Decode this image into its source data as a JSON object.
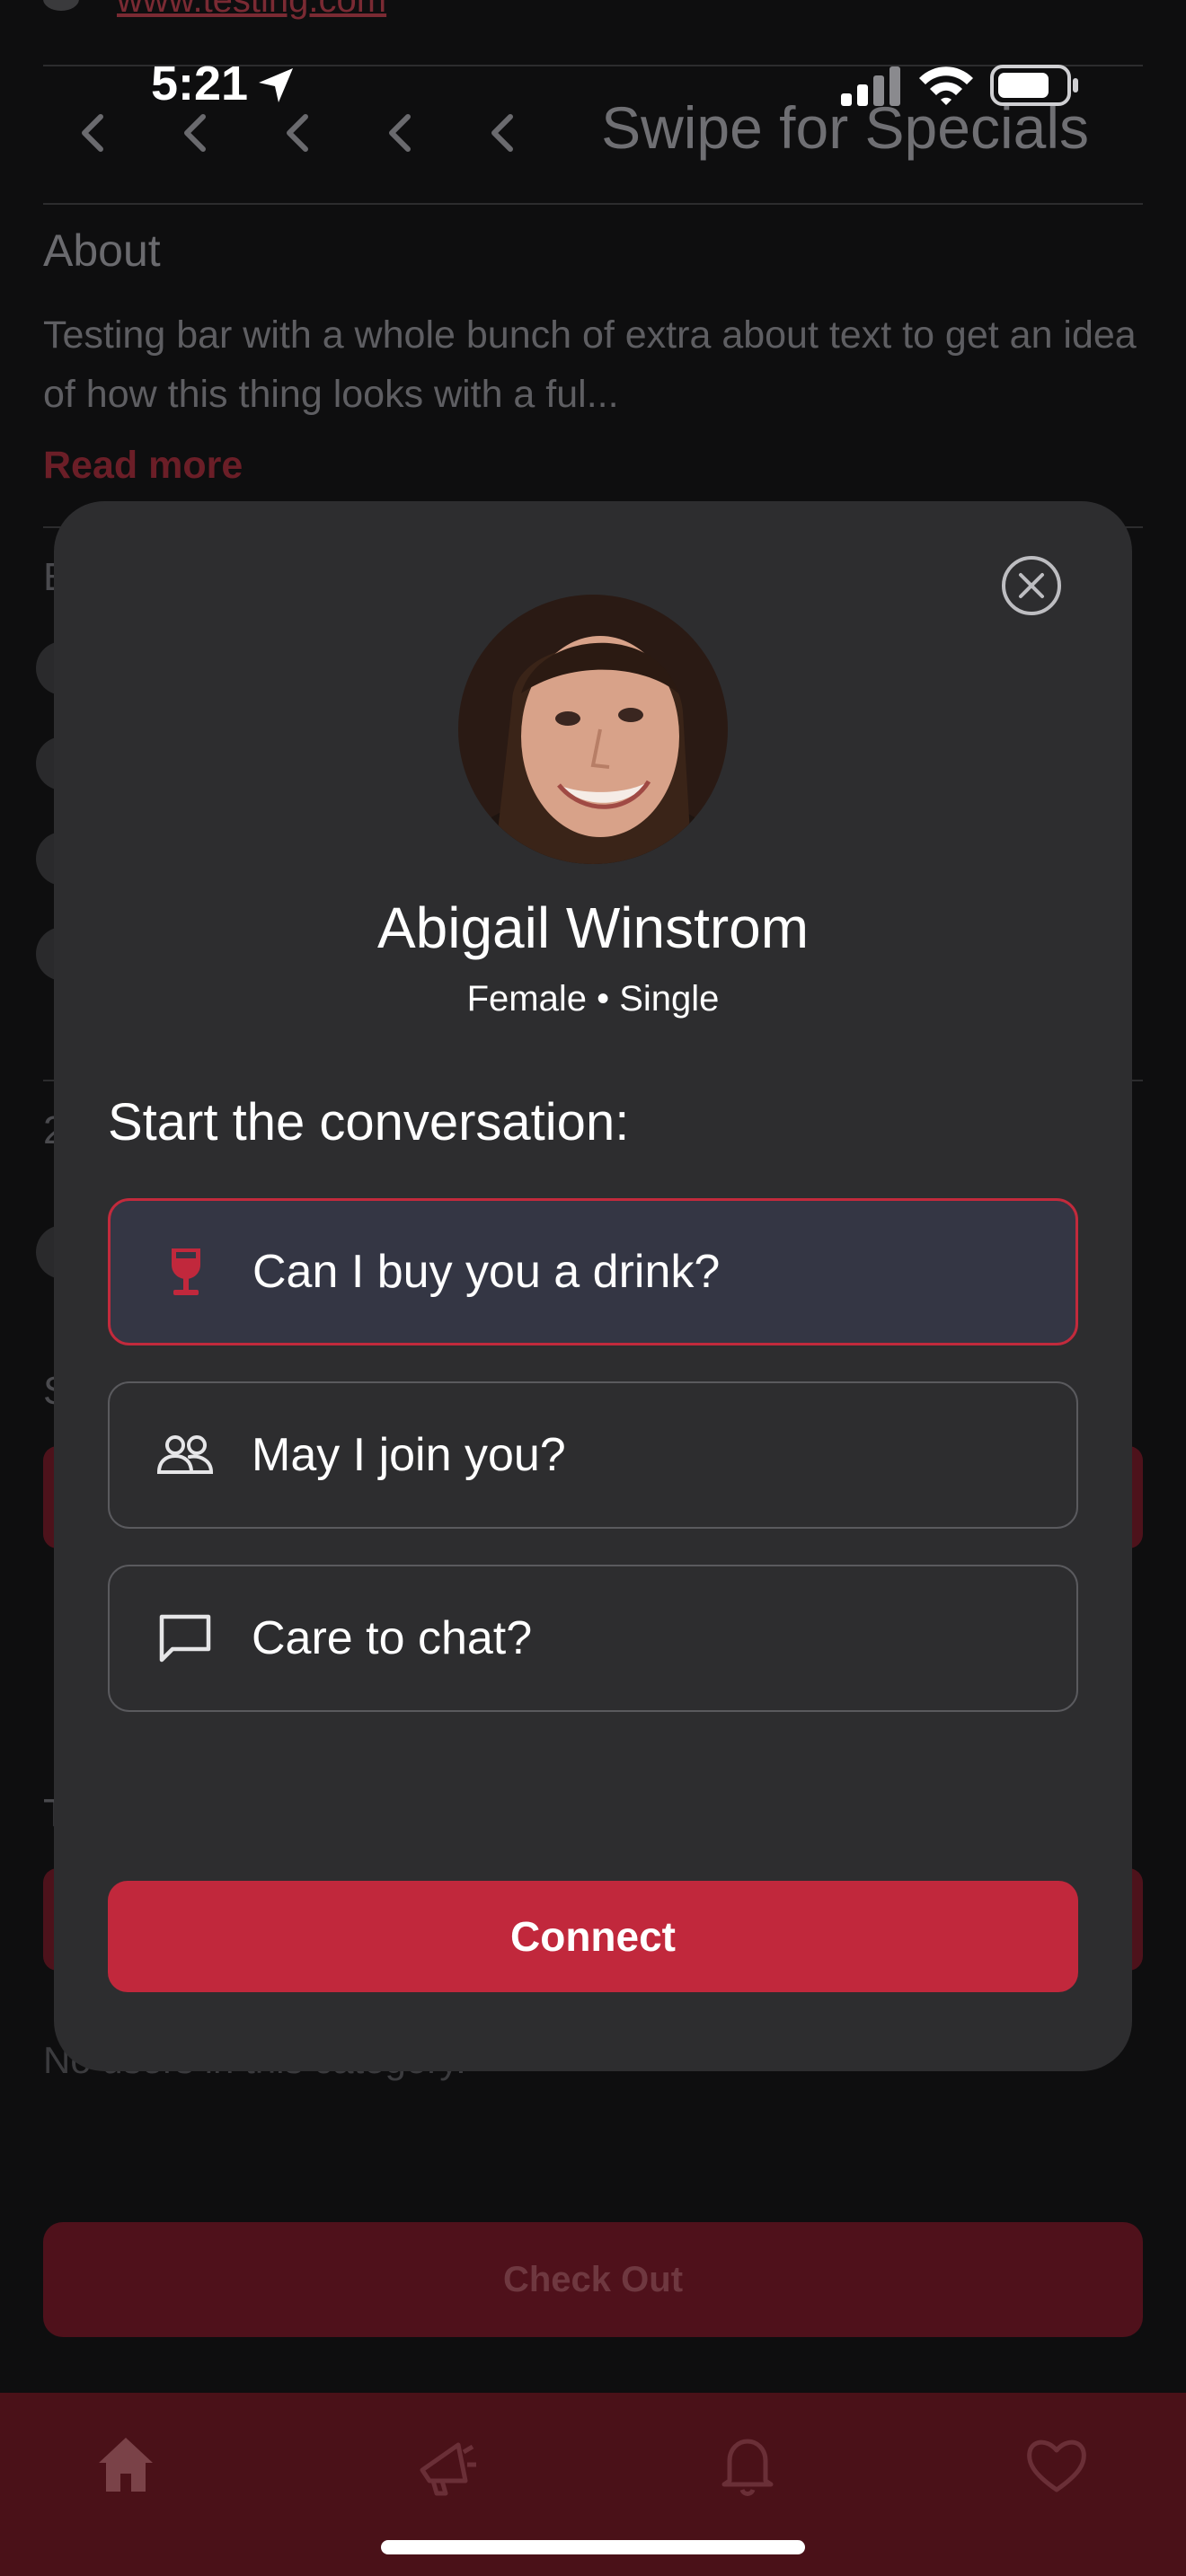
{
  "status_bar": {
    "time": "5:21"
  },
  "background": {
    "top_link": "www.testing.com",
    "nav_title": "Swipe for Specials",
    "about_heading": "About",
    "about_text": "Testing bar with a whole bunch of extra about text to get an idea of how this thing looks with a ful...",
    "read_more": "Read more",
    "partial_letters": [
      "E",
      "2",
      "S",
      "T"
    ],
    "empty_text": "No users in this category.",
    "checkout_label": "Check Out",
    "tabs": [
      "home-icon",
      "megaphone-icon",
      "bell-icon",
      "heart-icon"
    ]
  },
  "modal": {
    "name": "Abigail Winstrom",
    "subtitle": "Female • Single",
    "prompt": "Start the conversation:",
    "options": [
      {
        "label": "Can I buy you a drink?",
        "icon": "wine-glass-icon",
        "selected": true
      },
      {
        "label": "May I join you?",
        "icon": "people-icon",
        "selected": false
      },
      {
        "label": "Care to chat?",
        "icon": "chat-bubble-icon",
        "selected": false
      }
    ],
    "connect_label": "Connect"
  },
  "colors": {
    "accent": "#c1283c",
    "modal_bg": "#2d2d2f",
    "selected_bg": "#343644",
    "tabbar_bg": "#4a1118"
  }
}
